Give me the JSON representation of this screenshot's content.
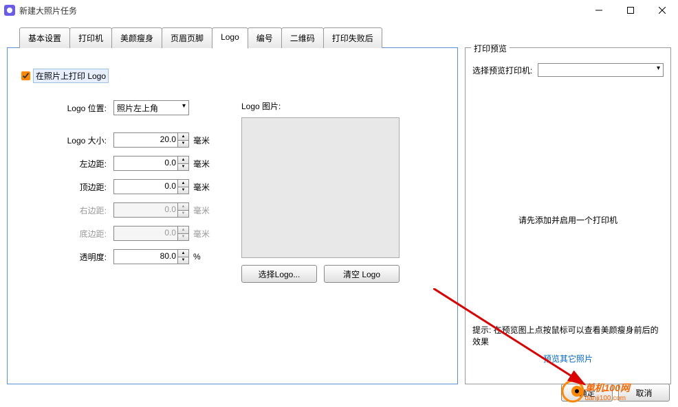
{
  "window": {
    "title": "新建大照片任务"
  },
  "tabs": [
    {
      "label": "基本设置",
      "active": false
    },
    {
      "label": "打印机",
      "active": false
    },
    {
      "label": "美颜瘦身",
      "active": false
    },
    {
      "label": "页眉页脚",
      "active": false
    },
    {
      "label": "Logo",
      "active": true
    },
    {
      "label": "编号",
      "active": false
    },
    {
      "label": "二维码",
      "active": false
    },
    {
      "label": "打印失败后",
      "active": false
    }
  ],
  "logo_panel": {
    "checkbox_label": "在照片上打印 Logo",
    "position_label": "Logo 位置:",
    "position_value": "照片左上角",
    "size_label": "Logo 大小:",
    "size_value": "20.0",
    "margin_left_label": "左边距:",
    "margin_left_value": "0.0",
    "margin_top_label": "顶边距:",
    "margin_top_value": "0.0",
    "margin_right_label": "右边距:",
    "margin_right_value": "0.0",
    "margin_bottom_label": "底边距:",
    "margin_bottom_value": "0.0",
    "opacity_label": "透明度:",
    "opacity_value": "80.0",
    "unit_mm": "毫米",
    "unit_pct": "%",
    "image_label": "Logo 图片:",
    "select_btn": "选择Logo...",
    "clear_btn": "清空 Logo"
  },
  "preview_panel": {
    "title": "打印预览",
    "printer_label": "选择预览打印机:",
    "placeholder": "请先添加并启用一个打印机",
    "tip": "提示: 在预览图上点按鼠标可以查看美颜瘦身前后的效果",
    "other_link": "预览其它照片"
  },
  "buttons": {
    "ok": "确定",
    "cancel": "取消"
  },
  "watermark": {
    "text": "单机100网",
    "url": "danji100.com"
  }
}
